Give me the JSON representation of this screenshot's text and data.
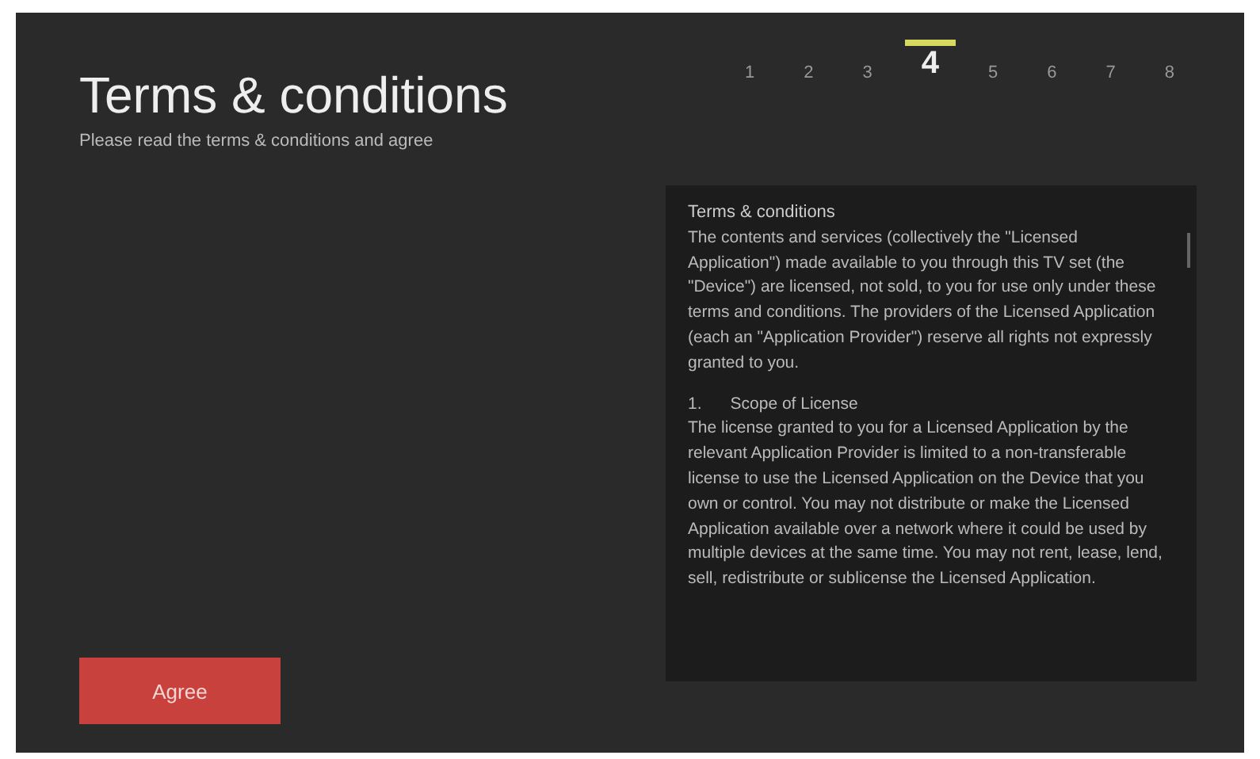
{
  "title": "Terms & conditions",
  "subtitle": "Please read the terms & conditions and agree",
  "steps": [
    {
      "label": "1",
      "selected": false
    },
    {
      "label": "2",
      "selected": false
    },
    {
      "label": "3",
      "selected": false
    },
    {
      "label": "4",
      "selected": true
    },
    {
      "label": "5",
      "selected": false
    },
    {
      "label": "6",
      "selected": false
    },
    {
      "label": "7",
      "selected": false
    },
    {
      "label": "8",
      "selected": false
    }
  ],
  "terms": {
    "heading": "Terms & conditions",
    "blocks": [
      {
        "kind": "paragraph",
        "text": "The contents and services (collectively the \"Licensed Application\") made available to you through this TV set (the \"Device\") are licensed, not sold, to you for use only under these terms and conditions. The providers of the Licensed Application (each an \"Application Provider\") reserve all rights not expressly granted to you."
      },
      {
        "kind": "section",
        "number": "1.",
        "text": "Scope of License"
      },
      {
        "kind": "paragraph",
        "text": "The license granted to you for a Licensed Application by the relevant Application Provider is limited to a non-transferable license to use the Licensed Application on the Device that you own or control. You may not distribute or make the Licensed Application available over a network where it could be used by multiple devices at the same time. You may not rent, lease, lend, sell, redistribute or sublicense the Licensed Application."
      }
    ]
  },
  "agree_button": "Agree"
}
